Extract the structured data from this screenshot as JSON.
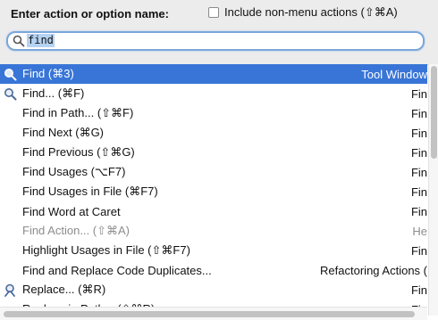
{
  "header": {
    "prompt": "Enter action or option name:",
    "include_label": "Include non-menu actions (⇧⌘A)",
    "include_checked": false
  },
  "search": {
    "value": "find"
  },
  "results": [
    {
      "label": "Find (⌘3)",
      "group": "Tool Window",
      "icon": "search-icon",
      "selected": true,
      "disabled": false
    },
    {
      "label": "Find... (⌘F)",
      "group": "Fin",
      "icon": "search-icon",
      "selected": false,
      "disabled": false
    },
    {
      "label": "Find in Path... (⇧⌘F)",
      "group": "Fin",
      "icon": "",
      "selected": false,
      "disabled": false
    },
    {
      "label": "Find Next (⌘G)",
      "group": "Fin",
      "icon": "",
      "selected": false,
      "disabled": false
    },
    {
      "label": "Find Previous (⇧⌘G)",
      "group": "Fin",
      "icon": "",
      "selected": false,
      "disabled": false
    },
    {
      "label": "Find Usages (⌥F7)",
      "group": "Fin",
      "icon": "",
      "selected": false,
      "disabled": false
    },
    {
      "label": "Find Usages in File (⌘F7)",
      "group": "Fin",
      "icon": "",
      "selected": false,
      "disabled": false
    },
    {
      "label": "Find Word at Caret",
      "group": "Fin",
      "icon": "",
      "selected": false,
      "disabled": false
    },
    {
      "label": "Find Action... (⇧⌘A)",
      "group": "He",
      "icon": "",
      "selected": false,
      "disabled": true
    },
    {
      "label": "Highlight Usages in File (⇧⌘F7)",
      "group": "Fin",
      "icon": "",
      "selected": false,
      "disabled": false
    },
    {
      "label": "Find and Replace Code Duplicates...",
      "group": "Refactoring Actions (",
      "icon": "",
      "selected": false,
      "disabled": false
    },
    {
      "label": "Replace... (⌘R)",
      "group": "Fin",
      "icon": "replace-icon",
      "selected": false,
      "disabled": false
    },
    {
      "label": "Replace in Path... (⇧⌘R)",
      "group": "Fin",
      "icon": "",
      "selected": false,
      "disabled": false
    }
  ]
}
